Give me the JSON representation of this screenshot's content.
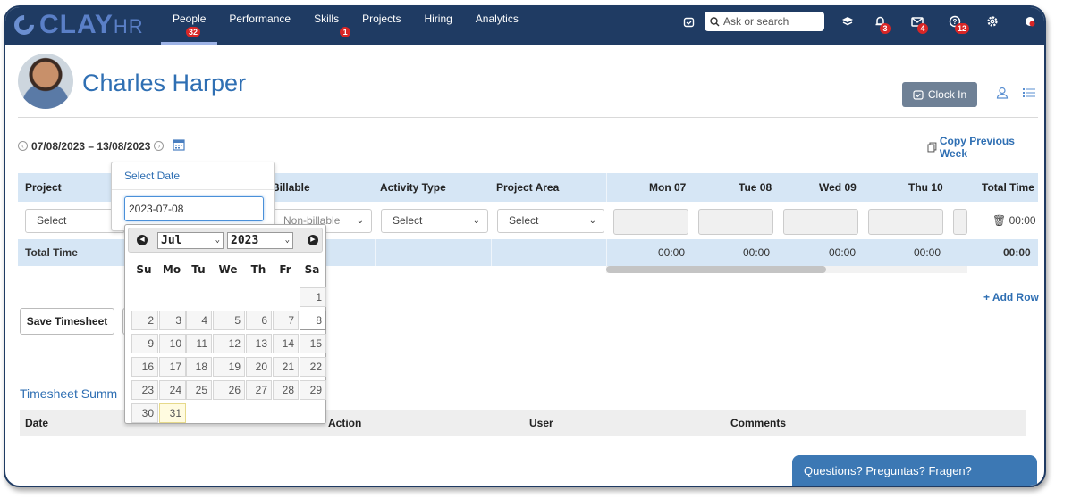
{
  "app": {
    "logo_text": "CLAY",
    "logo_suffix": "HR"
  },
  "nav": {
    "links": [
      {
        "label": "People",
        "badge": "32"
      },
      {
        "label": "Performance"
      },
      {
        "label": "Skills",
        "badge": "1"
      },
      {
        "label": "Projects"
      },
      {
        "label": "Hiring"
      },
      {
        "label": "Analytics"
      }
    ],
    "search_placeholder": "Ask or search",
    "notification_badge": "3",
    "mail_badge": "4",
    "help_badge": "12"
  },
  "header": {
    "person_name": "Charles Harper",
    "clock_in_label": "Clock In"
  },
  "timesheet": {
    "date_range": "07/08/2023 – 13/08/2023",
    "copy_previous_label": "Copy Previous Week",
    "columns": {
      "project": "Project",
      "billable": "Billable",
      "activity_type": "Activity Type",
      "project_area": "Project Area",
      "mon": "Mon 07",
      "tue": "Tue 08",
      "wed": "Wed 09",
      "thu": "Thu 10",
      "total": "Total Time"
    },
    "row": {
      "project_select": "Select",
      "billable_select": "Non-billable",
      "activity_select": "Select",
      "area_select": "Select",
      "total": "00:00"
    },
    "footer": {
      "label": "Total Time",
      "mon": "00:00",
      "tue": "00:00",
      "wed": "00:00",
      "thu": "00:00",
      "total": "00:00"
    },
    "add_row_label": "+ Add Row",
    "save_label": "Save Timesheet"
  },
  "summary": {
    "title": "Timesheet Summ",
    "columns": {
      "date": "Date",
      "action": "Action",
      "user": "User",
      "comments": "Comments"
    }
  },
  "datepicker": {
    "title": "Select Date",
    "value": "2023-07-08",
    "month": "Jul",
    "year": "2023",
    "weekdays": [
      "Su",
      "Mo",
      "Tu",
      "We",
      "Th",
      "Fr",
      "Sa"
    ],
    "weeks": [
      [
        "",
        "",
        "",
        "",
        "",
        "",
        "1"
      ],
      [
        "2",
        "3",
        "4",
        "5",
        "6",
        "7",
        "8"
      ],
      [
        "9",
        "10",
        "11",
        "12",
        "13",
        "14",
        "15"
      ],
      [
        "16",
        "17",
        "18",
        "19",
        "20",
        "21",
        "22"
      ],
      [
        "23",
        "24",
        "25",
        "26",
        "27",
        "28",
        "29"
      ],
      [
        "30",
        "31",
        "",
        "",
        "",
        "",
        ""
      ]
    ],
    "selected_day": "8",
    "today": "31"
  },
  "chat": {
    "label": "Questions? Preguntas? Fragen?"
  },
  "colors": {
    "nav_bg": "#1f3b63",
    "accent": "#2f6fb3",
    "badge": "#d92626"
  }
}
